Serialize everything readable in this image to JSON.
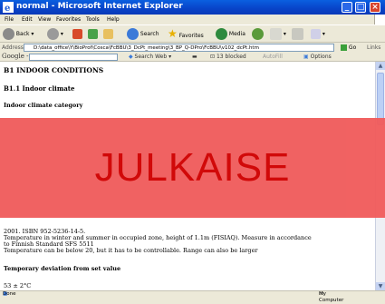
{
  "window": {
    "title": "normal - Microsoft Internet Explorer"
  },
  "menu": [
    "File",
    "Edit",
    "View",
    "Favorites",
    "Tools",
    "Help"
  ],
  "toolbar": {
    "back": "Back",
    "search": "Search",
    "favorites": "Favorites",
    "media": "Media"
  },
  "address": {
    "label": "Address",
    "url": "D:\\data_office\\Y\\BioProf\\Cosca\\FcBBU\\3_DcPt_meeting\\3_BP_Q-DPro\\FcBBU\\v102_dcPt.htm",
    "go": "Go",
    "links": "Links"
  },
  "google": {
    "logo": "Google -",
    "search_web": "Search Web",
    "blocked": "13 blocked",
    "autofill": "AutoFill",
    "options": "Options"
  },
  "document": {
    "heading": "B1 INDOOR CONDITIONS",
    "subheading": "B1.1 Indoor climate",
    "category_label": "Indoor climate category",
    "text_lines": [
      "2001. ISBN 952-5236-14-5.",
      "Temperature in winter and summer in occupied zone, height of 1.1m (FISIAQ). Measure in accordance",
      "to Finnish Standard SFS 5511",
      "Temperature can be below 20, but it has to be controllable. Range can also be larger"
    ],
    "deviation_label": "Temporary deviation from set value",
    "deviation_value": "53 ± 2°C"
  },
  "watermark": {
    "text": "JULKAISE"
  },
  "status": {
    "left": "Done",
    "right": "My Computer"
  },
  "colors": {
    "titlebar": "#0843c8",
    "banner": "#f05c5c",
    "banner_text": "#d00000"
  }
}
